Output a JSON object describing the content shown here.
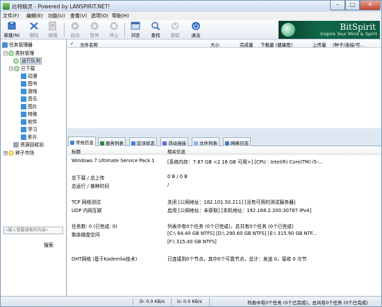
{
  "window": {
    "title": "比特精灵 - Powered by LANSPIRIT.NET!",
    "min_glyph": "–",
    "max_glyph": "□",
    "close_glyph": "✕"
  },
  "menu": [
    "文件(F)",
    "编辑(E)",
    "功能(U)",
    "查看(V)",
    "选项(O)",
    "帮助(H)"
  ],
  "toolbar": {
    "new": "新建(N)",
    "delete": "删除",
    "edit": "编辑",
    "start": "启动",
    "pause": "暂停",
    "stop": "停止",
    "browse": "浏览",
    "find": "查找",
    "hunt": "猎狐",
    "exit": "退出"
  },
  "banner": {
    "name": "BitSpirit",
    "slogan": "Inspire Your Mind & Spirit"
  },
  "tree": {
    "root": "任务管理器",
    "category": "类别管理",
    "running": "运行队列",
    "downloaded": "已下载",
    "children": [
      "动漫",
      "图书",
      "游戏",
      "音乐",
      "图片",
      "特殊",
      "软件",
      "学习",
      "影片"
    ],
    "recycle": "资源回收站",
    "market": "种子市场"
  },
  "search": {
    "placeholder": "<输入想要搜索的内容>",
    "button": "搜索"
  },
  "list_header": {
    "name": "文件名称",
    "size": "大小",
    "done": "完成量",
    "dl": "下载量 (健康度)",
    "ul": "上传量",
    "seeds": "(种子/连接/可..."
  },
  "tabs": [
    "常规信息",
    "服务列表",
    "区块状态",
    "活动连接",
    "文件列表",
    "网络日志"
  ],
  "detail_header": {
    "title": "标题",
    "info": "相关信息"
  },
  "detail_rows": [
    {
      "k": "Windows 7 Ultimate Service Pack 1",
      "v": "[系统内存：7.87 GB <2.16 GB 可用>] [CPU : Intel(R) Core(TM) i5-..."
    },
    {
      "k": "总下载 / 总上传",
      "v": "0 B / 0 B"
    },
    {
      "k": "总运行 / 做种时间",
      "v": "/"
    },
    {
      "k": "TCP 网络测试",
      "v": "关闭 [公网地址：182.101.50.211] [没有可用的测试服务器]"
    },
    {
      "k": "UDP 内网互联",
      "v": "启用 [公网地址：未获取] [本机地址：192.168.2.200:30787 IPv4]"
    },
    {
      "k": "任务数: 0 (已完成: 0)",
      "v": "列表中有0个任务 (0个已完成)，总共有0个任务 (0个已完成)"
    },
    {
      "k": "剩余磁盘空间",
      "v": "[C:\\ 84.40 GB  NTFS]  [D:\\ 290.60 GB  NTFS]  [E:\\ 315.90 GB  NTF..."
    },
    {
      "k": "",
      "v": "[F:\\ 315.40 GB  NTFS]"
    },
    {
      "k": "DHT网络 (基于Kademlia技术)",
      "v": "已连接到0个节点，其中0个可靠节点，总计：发送 0，接收 0 次节"
    }
  ],
  "status": {
    "down": "D: 0.0 KB/s",
    "up": "U: 0.0 KB/s",
    "summary": "列表中有0个任务 (0个已完成)，总共有0个任务 (0个已完成)"
  }
}
